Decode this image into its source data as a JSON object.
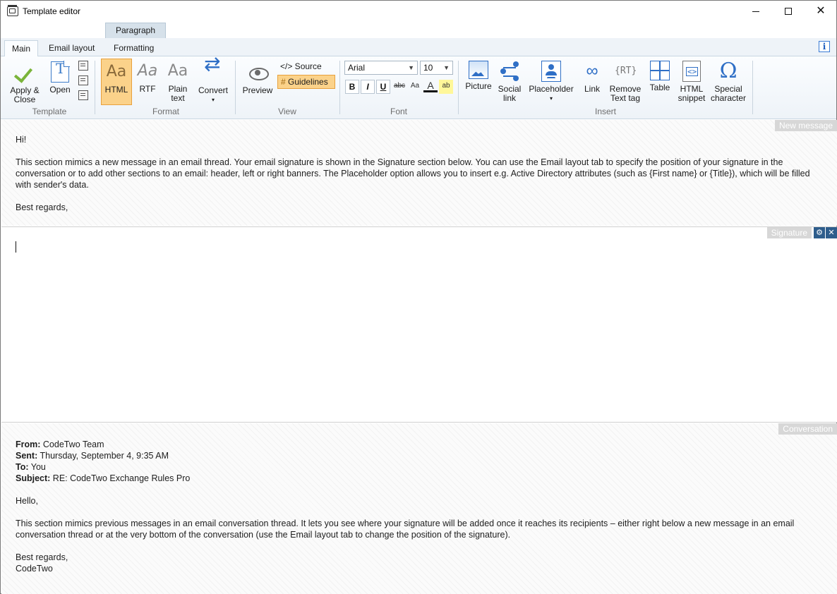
{
  "window": {
    "title": "Template editor"
  },
  "ribbon": {
    "context_tab": "Paragraph",
    "tabs": [
      {
        "label": "Main",
        "active": true
      },
      {
        "label": "Email layout",
        "active": false
      },
      {
        "label": "Formatting",
        "active": false
      }
    ],
    "info_label": "i",
    "groups": {
      "template": {
        "label": "Template",
        "apply_close": "Apply &\nClose",
        "apply_close_l1": "Apply &",
        "apply_close_l2": "Close",
        "open": "Open"
      },
      "format": {
        "label": "Format",
        "html": "HTML",
        "rtf": "RTF",
        "plain_l1": "Plain",
        "plain_l2": "text",
        "convert": "Convert",
        "aa": "Aa",
        "selected": "HTML"
      },
      "view": {
        "label": "View",
        "preview": "Preview",
        "source": "</> Source",
        "guidelines": "Guidelines"
      },
      "font": {
        "label": "Font",
        "family": "Arial",
        "size": "10",
        "bold": "B",
        "italic": "I",
        "underline": "U",
        "strike": "abc",
        "case": "Aa",
        "color": "A",
        "highlight": "ab"
      },
      "insert": {
        "label": "Insert",
        "picture": "Picture",
        "social_l1": "Social",
        "social_l2": "link",
        "placeholder": "Placeholder",
        "link": "Link",
        "remove_l1": "Remove",
        "remove_l2": "Text tag",
        "rt": "{RT}",
        "table": "Table",
        "snippet_l1": "HTML",
        "snippet_l2": "snippet",
        "snippet_glyph": "<>",
        "special_l1": "Special",
        "special_l2": "character",
        "omega": "Ω"
      }
    }
  },
  "sections": {
    "new_message": {
      "label": "New message",
      "greeting": "Hi!",
      "body": "This section mimics a new message in an email thread. Your email signature is shown in the Signature section below. You can use the Email layout tab to specify the position of your signature in the conversation or to add other sections to an email: header, left or right banners. The Placeholder option allows you to insert e.g. Active Directory attributes (such as {First name} or {Title}), which will be filled with sender's data.",
      "closing": "Best regards,"
    },
    "signature": {
      "label": "Signature"
    },
    "conversation": {
      "label": "Conversation",
      "from_label": "From:",
      "from": "CodeTwo Team",
      "sent_label": "Sent:",
      "sent": "Thursday, September 4, 9:35 AM",
      "to_label": "To:",
      "to": "You",
      "subject_label": "Subject:",
      "subject": "RE: CodeTwo Exchange Rules Pro",
      "greeting": "Hello,",
      "body": "This section mimics previous messages in an email conversation thread. It lets you see where your signature will be added once it reaches its recipients – either right below a new message in an email conversation thread or at the very bottom of the conversation (use the Email layout tab to change the position of the signature).",
      "closing": "Best regards,",
      "sender": "CodeTwo"
    }
  }
}
